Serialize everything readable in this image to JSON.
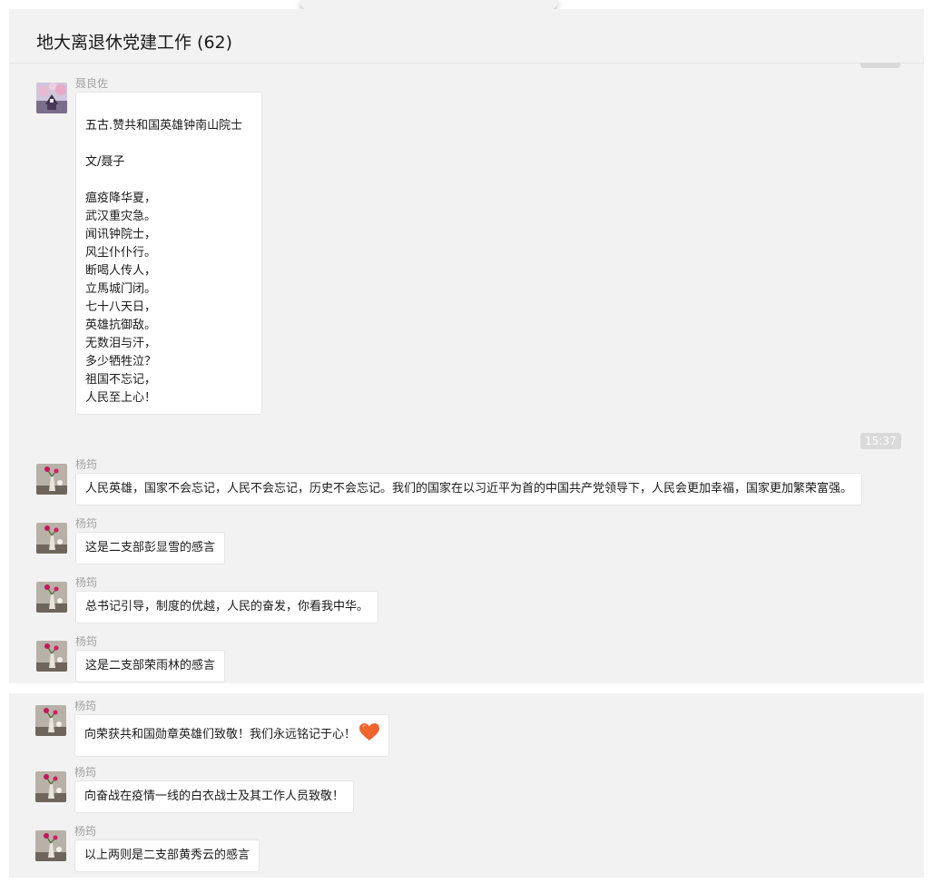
{
  "chat": {
    "title": "地大离退休党建工作 (62)"
  },
  "timestamps": {
    "t1": "15:37"
  },
  "messages": [
    {
      "sender": "聂良佐",
      "avatar": "cherry-blossom-avatar",
      "lines": [
        "",
        "五古.赞共和国英雄钟南山院士",
        "",
        "文/聂子",
        "",
        "瘟疫降华夏，",
        "武汉重灾急。",
        "闻讯钟院士，",
        "风尘仆仆行。",
        "断喝人传人，",
        "立馬城门闭。",
        "七十八天日，",
        "英雄抗御敌。",
        "无数泪与汗，",
        "多少牺牲泣？",
        "祖国不忘记，",
        "人民至上心！"
      ]
    },
    {
      "sender": "杨筠",
      "avatar": "flower-vase-avatar",
      "text": "人民英雄，国家不会忘记，人民不会忘记，历史不会忘记。我们的国家在以习近平为首的中国共产党领导下，人民会更加幸福，国家更加繁荣富强。"
    },
    {
      "sender": "杨筠",
      "avatar": "flower-vase-avatar",
      "text": "这是二支部彭显雪的感言"
    },
    {
      "sender": "杨筠",
      "avatar": "flower-vase-avatar",
      "text": "总书记引导，制度的优越，人民的奋发，你看我中华。"
    },
    {
      "sender": "杨筠",
      "avatar": "flower-vase-avatar",
      "text": "这是二支部荣雨林的感言"
    },
    {
      "sender": "杨筠",
      "avatar": "flower-vase-avatar",
      "text": "向荣获共和国勋章英雄们致敬！我们永远铭记于心！",
      "emoji": "heart-icon"
    },
    {
      "sender": "杨筠",
      "avatar": "flower-vase-avatar",
      "text": "向奋战在疫情一线的白衣战士及其工作人员致敬！"
    },
    {
      "sender": "杨筠",
      "avatar": "flower-vase-avatar",
      "text": "以上两则是二支部黄秀云的感言"
    }
  ],
  "colors": {
    "panel": "#f2f2f2",
    "bubble": "#ffffff",
    "sender": "#a3a3a3",
    "time_badge": "#dadada",
    "heart": "#f0642d"
  }
}
